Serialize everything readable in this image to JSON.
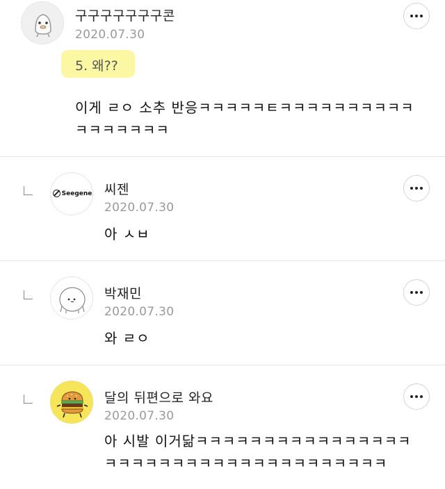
{
  "comments": [
    {
      "nickname": "구구구구구구구콘",
      "date": "2020.07.30",
      "subtitle": "5. 왜??",
      "text_line1": "이게 ㄹㅇ 소추 반응ㅋㅋㅋㅋㅋㅌㅋㅋㅋㅋㅋㅋㅋㅋㅋㅋ",
      "text_line2": "ㅋㅋㅋㅋㅋㅋㅋ"
    },
    {
      "nickname": "씨젠",
      "date": "2020.07.30",
      "avatar_text": "Seegene",
      "text_line1": "아 ㅅㅂ"
    },
    {
      "nickname": "박재민",
      "date": "2020.07.30",
      "text_line1": "와 ㄹㅇ"
    },
    {
      "nickname": "달의 뒤편으로 와요",
      "date": "2020.07.30",
      "text_line1": "아 시발 이거닮ㅋㅋㅋㅋㅋㅋㅋㅋㅋㅋㅋㅋㅋㅋㅋㅋ",
      "text_line2": "ㅋㅋㅋㅋㅋㅋㅋㅋㅋㅋㅋㅋㅋㅋㅋㅋㅋㅋㅋㅋㅋ"
    }
  ],
  "icons": {
    "more": "more-options-icon",
    "reply": "reply-arrow-icon"
  },
  "colors": {
    "highlight": "#fbf7a2",
    "date": "#9a9a9a",
    "divider": "#e6e6e6"
  }
}
